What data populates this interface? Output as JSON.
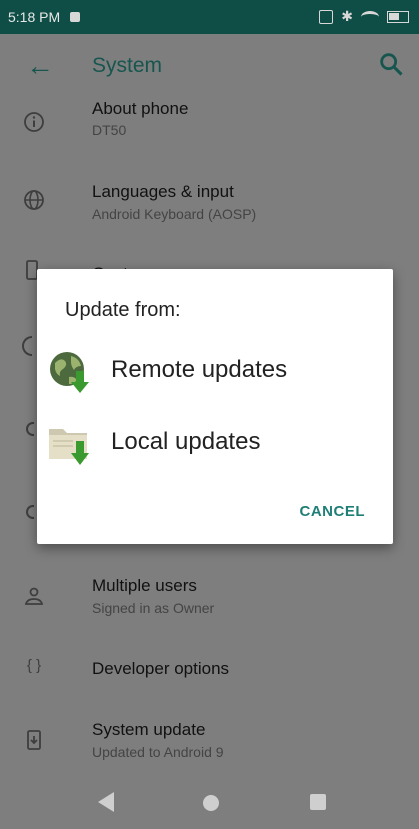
{
  "status_bar": {
    "time": "5:18 PM",
    "icons": [
      "notification-icon",
      "vibrate-icon",
      "bluetooth-icon",
      "wifi-icon",
      "battery-icon"
    ]
  },
  "toolbar": {
    "title": "System",
    "back_icon": "arrow-back-icon",
    "search_icon": "search-icon"
  },
  "list": [
    {
      "title": "About phone",
      "subtitle": "DT50",
      "icon": "info-icon"
    },
    {
      "title": "Languages & input",
      "subtitle": "Android Keyboard (AOSP)",
      "icon": "globe-icon"
    },
    {
      "title": "Gestures",
      "subtitle": "",
      "icon": "gestures-icon"
    },
    {
      "title": "Multiple users",
      "subtitle": "Signed in as Owner",
      "icon": "person-icon"
    },
    {
      "title": "Developer options",
      "subtitle": "",
      "icon": "code-braces-icon"
    },
    {
      "title": "System update",
      "subtitle": "Updated to Android 9",
      "icon": "system-update-icon"
    }
  ],
  "dialog": {
    "title": "Update from:",
    "options": [
      {
        "label": "Remote updates",
        "icon": "globe-download-icon"
      },
      {
        "label": "Local updates",
        "icon": "folder-download-icon"
      }
    ],
    "cancel_label": "CANCEL"
  },
  "colors": {
    "accent": "#1f7f76",
    "status_bar": "#0f4e46",
    "scrim": "#7e7e7e"
  }
}
